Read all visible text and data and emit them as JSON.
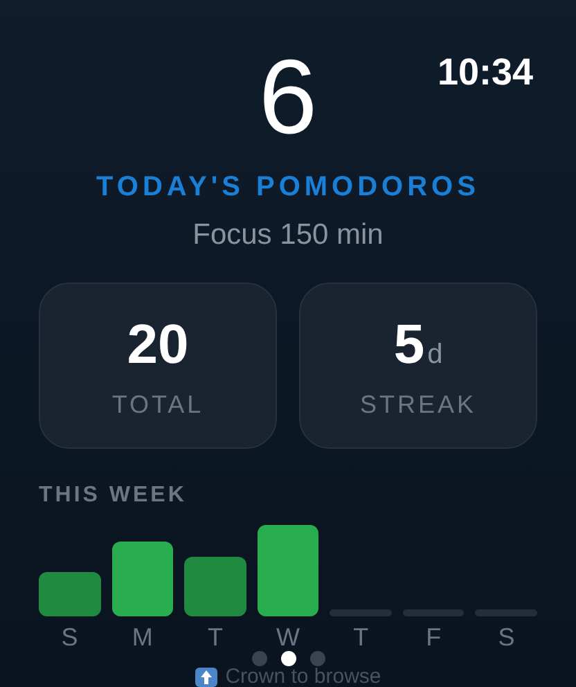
{
  "status_bar": {
    "time": "10:34"
  },
  "today": {
    "count": "6",
    "title": "TODAY'S POMODOROS",
    "subtitle": "Focus 150 min"
  },
  "stats": [
    {
      "value": "20",
      "label": "TOTAL"
    },
    {
      "value": "5",
      "unit": "d",
      "label": "STREAK"
    }
  ],
  "week": {
    "title": "THIS WEEK",
    "days": [
      {
        "label": "S",
        "kind": "filled",
        "color": "#1f8a40"
      },
      {
        "label": "M",
        "kind": "filled",
        "color": "#2aad4f"
      },
      {
        "label": "T",
        "kind": "filled",
        "color": "#1f8a40"
      },
      {
        "label": "W",
        "kind": "filled",
        "color": "#2aad4f"
      },
      {
        "label": "T",
        "kind": "empty"
      },
      {
        "label": "F",
        "kind": "empty"
      },
      {
        "label": "S",
        "kind": "empty"
      }
    ]
  },
  "pages": [
    {
      "selected": false
    },
    {
      "selected": true
    },
    {
      "selected": false
    }
  ],
  "hint": "Crown to browse"
}
